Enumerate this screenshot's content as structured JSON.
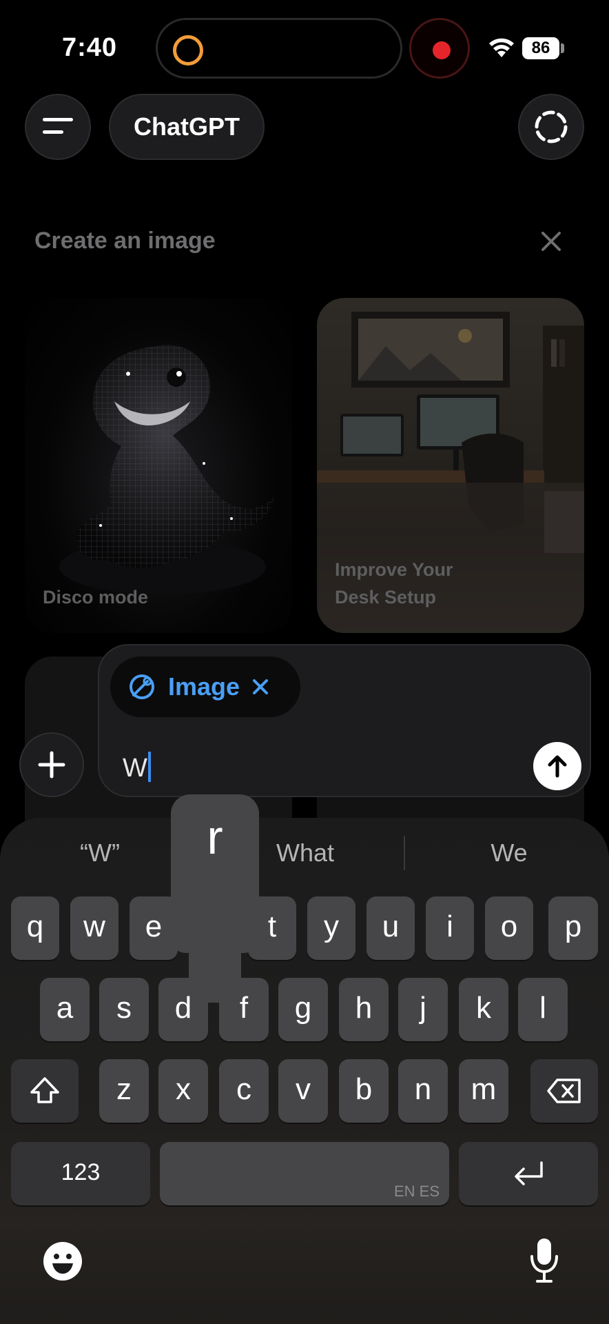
{
  "status_bar": {
    "time": "7:40",
    "battery": "86"
  },
  "top_bar": {
    "title": "ChatGPT"
  },
  "create_image": {
    "heading": "Create an image",
    "cards": [
      {
        "label": "Disco mode"
      },
      {
        "label_line1": "Improve Your",
        "label_line2": "Desk Setup"
      }
    ]
  },
  "composer": {
    "chip_label": "Image",
    "input_value": "W"
  },
  "keyboard": {
    "suggestions": [
      "“W”",
      "What",
      "We"
    ],
    "pressed_key": "r",
    "row1": [
      "q",
      "w",
      "e",
      "r",
      "t",
      "y",
      "u",
      "i",
      "o",
      "p"
    ],
    "row2": [
      "a",
      "s",
      "d",
      "f",
      "g",
      "h",
      "j",
      "k",
      "l"
    ],
    "row3": [
      "z",
      "x",
      "c",
      "v",
      "b",
      "n",
      "m"
    ],
    "numbers_key": "123",
    "space_hint": "EN ES"
  },
  "colors": {
    "accent": "#4a9ff5",
    "record": "#e5252b",
    "island_ring": "#f39c3a"
  }
}
